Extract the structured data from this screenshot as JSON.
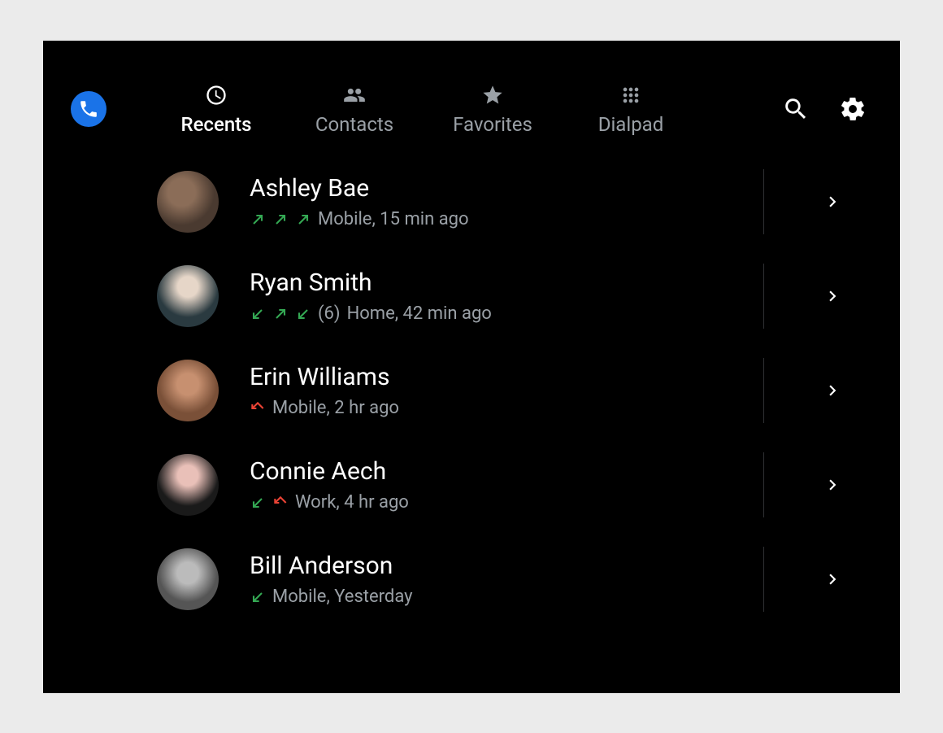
{
  "colors": {
    "accent": "#1a73e8",
    "outgoing": "#34a853",
    "incoming": "#34a853",
    "missed": "#ea4335",
    "muted": "#9aa0a6"
  },
  "tabs": [
    {
      "id": "recents",
      "label": "Recents",
      "icon": "clock-icon",
      "active": true
    },
    {
      "id": "contacts",
      "label": "Contacts",
      "icon": "people-icon",
      "active": false
    },
    {
      "id": "favorites",
      "label": "Favorites",
      "icon": "star-icon",
      "active": false
    },
    {
      "id": "dialpad",
      "label": "Dialpad",
      "icon": "dialpad-icon",
      "active": false
    }
  ],
  "toolbar": {
    "app_icon": "phone-icon",
    "search_icon": "search-icon",
    "settings_icon": "gear-icon"
  },
  "recents": [
    {
      "name": "Ashley Bae",
      "avatar_class": "av1",
      "calls": [
        {
          "type": "outgoing",
          "color": "#34a853"
        },
        {
          "type": "outgoing",
          "color": "#34a853"
        },
        {
          "type": "outgoing",
          "color": "#34a853"
        }
      ],
      "count_extra": "",
      "line_label": "Mobile",
      "time_label": "15 min ago"
    },
    {
      "name": "Ryan Smith",
      "avatar_class": "av2",
      "calls": [
        {
          "type": "incoming",
          "color": "#34a853"
        },
        {
          "type": "outgoing",
          "color": "#34a853"
        },
        {
          "type": "incoming",
          "color": "#34a853"
        }
      ],
      "count_extra": "(6)",
      "line_label": "Home",
      "time_label": "42 min ago"
    },
    {
      "name": "Erin Williams",
      "avatar_class": "av3",
      "calls": [
        {
          "type": "missed",
          "color": "#ea4335"
        }
      ],
      "count_extra": "",
      "line_label": "Mobile",
      "time_label": "2 hr ago"
    },
    {
      "name": "Connie Aech",
      "avatar_class": "av4",
      "calls": [
        {
          "type": "incoming",
          "color": "#34a853"
        },
        {
          "type": "missed",
          "color": "#ea4335"
        }
      ],
      "count_extra": "",
      "line_label": "Work",
      "time_label": "4 hr ago"
    },
    {
      "name": "Bill Anderson",
      "avatar_class": "av5",
      "calls": [
        {
          "type": "incoming",
          "color": "#34a853"
        }
      ],
      "count_extra": "",
      "line_label": "Mobile",
      "time_label": "Yesterday"
    }
  ]
}
